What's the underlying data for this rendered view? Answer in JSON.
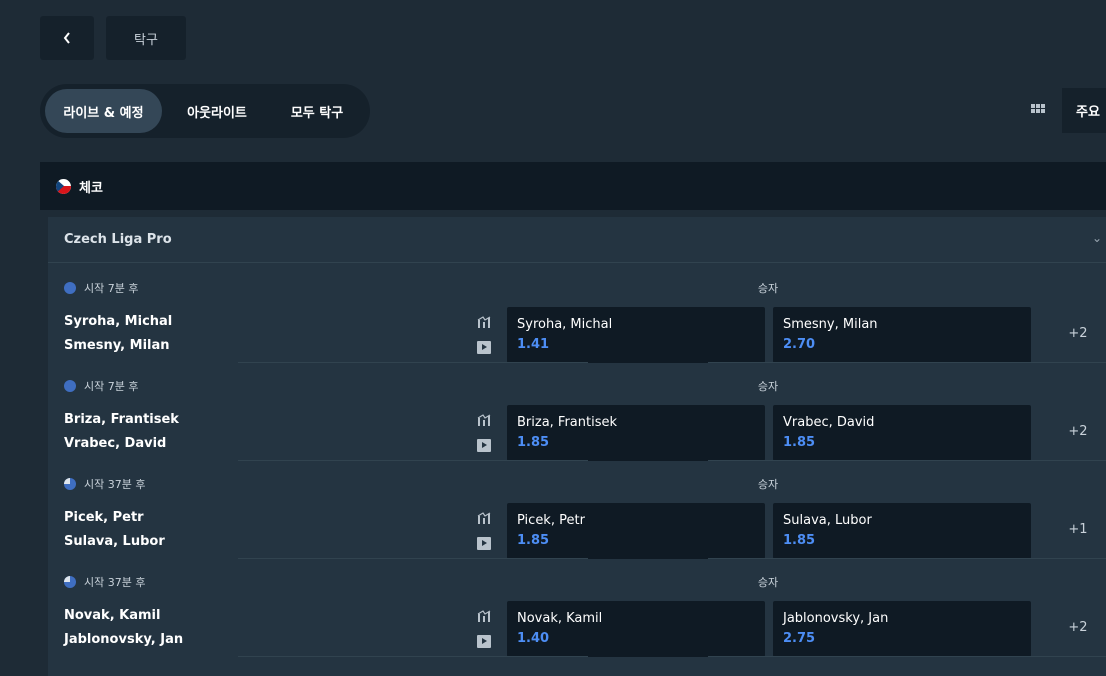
{
  "header": {
    "back_label": "‹",
    "breadcrumb": "탁구"
  },
  "filters": {
    "tabs": [
      {
        "label": "라이브 & 예정",
        "active": true
      },
      {
        "label": "아웃라이트",
        "active": false
      },
      {
        "label": "모두 탁구",
        "active": false
      }
    ],
    "view_icon": "grid-icon",
    "main_markets_label": "주요"
  },
  "country": {
    "name": "체코",
    "flag_icon": "czech-flag-icon"
  },
  "league": {
    "name": "Czech Liga Pro",
    "matches": [
      {
        "time": "시작 7분 후",
        "market": "승자",
        "player1": "Syroha, Michal",
        "player2": "Smesny, Milan",
        "odds": [
          {
            "name": "Syroha, Michal",
            "price": "1.41"
          },
          {
            "name": "Smesny, Milan",
            "price": "2.70"
          }
        ],
        "more": "+2"
      },
      {
        "time": "시작 7분 후",
        "market": "승자",
        "player1": "Briza, Frantisek",
        "player2": "Vrabec, David",
        "odds": [
          {
            "name": "Briza, Frantisek",
            "price": "1.85"
          },
          {
            "name": "Vrabec, David",
            "price": "1.85"
          }
        ],
        "more": "+2"
      },
      {
        "time": "시작 37분 후",
        "market": "승자",
        "player1": "Picek, Petr",
        "player2": "Sulava, Lubor",
        "odds": [
          {
            "name": "Picek, Petr",
            "price": "1.85"
          },
          {
            "name": "Sulava, Lubor",
            "price": "1.85"
          }
        ],
        "more": "+1"
      },
      {
        "time": "시작 37분 후",
        "market": "승자",
        "player1": "Novak, Kamil",
        "player2": "Jablonovsky, Jan",
        "odds": [
          {
            "name": "Novak, Kamil",
            "price": "1.40"
          },
          {
            "name": "Jablonovsky, Jan",
            "price": "2.75"
          }
        ],
        "more": "+2"
      }
    ]
  },
  "colors": {
    "background": "#1e2b36",
    "panel": "#15212b",
    "odds_price": "#4d8ef5"
  }
}
